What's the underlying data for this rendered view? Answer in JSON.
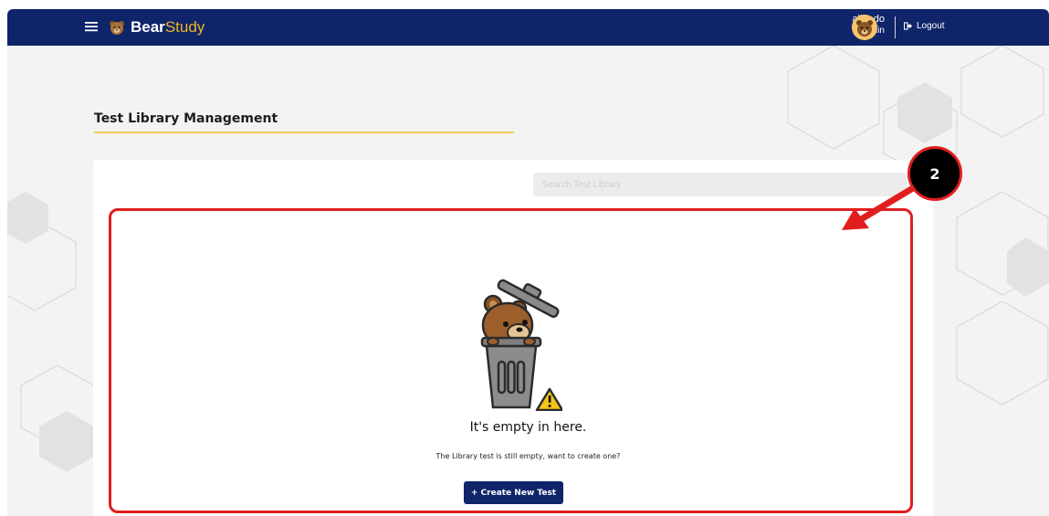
{
  "header": {
    "brand_part1": "Bear",
    "brand_part2": "Study",
    "user_name": "aliando",
    "user_role": "admin",
    "logout_label": "Logout",
    "menu_icon": "hamburger-icon",
    "logout_icon": "logout-icon"
  },
  "main": {
    "title": "Test Library Management",
    "search": {
      "placeholder": "Search Test Library",
      "value": ""
    },
    "empty_state": {
      "title": "It's empty in here.",
      "subtitle": "The Library test is still empty, want to create one?",
      "button_label": "+ Create New Test"
    }
  },
  "annotation": {
    "step_number": "2"
  },
  "colors": {
    "navbar": "#0f2469",
    "brand_accent": "#f1b61f",
    "underline": "#f1c95e",
    "annotation_red": "#e01e1e"
  }
}
